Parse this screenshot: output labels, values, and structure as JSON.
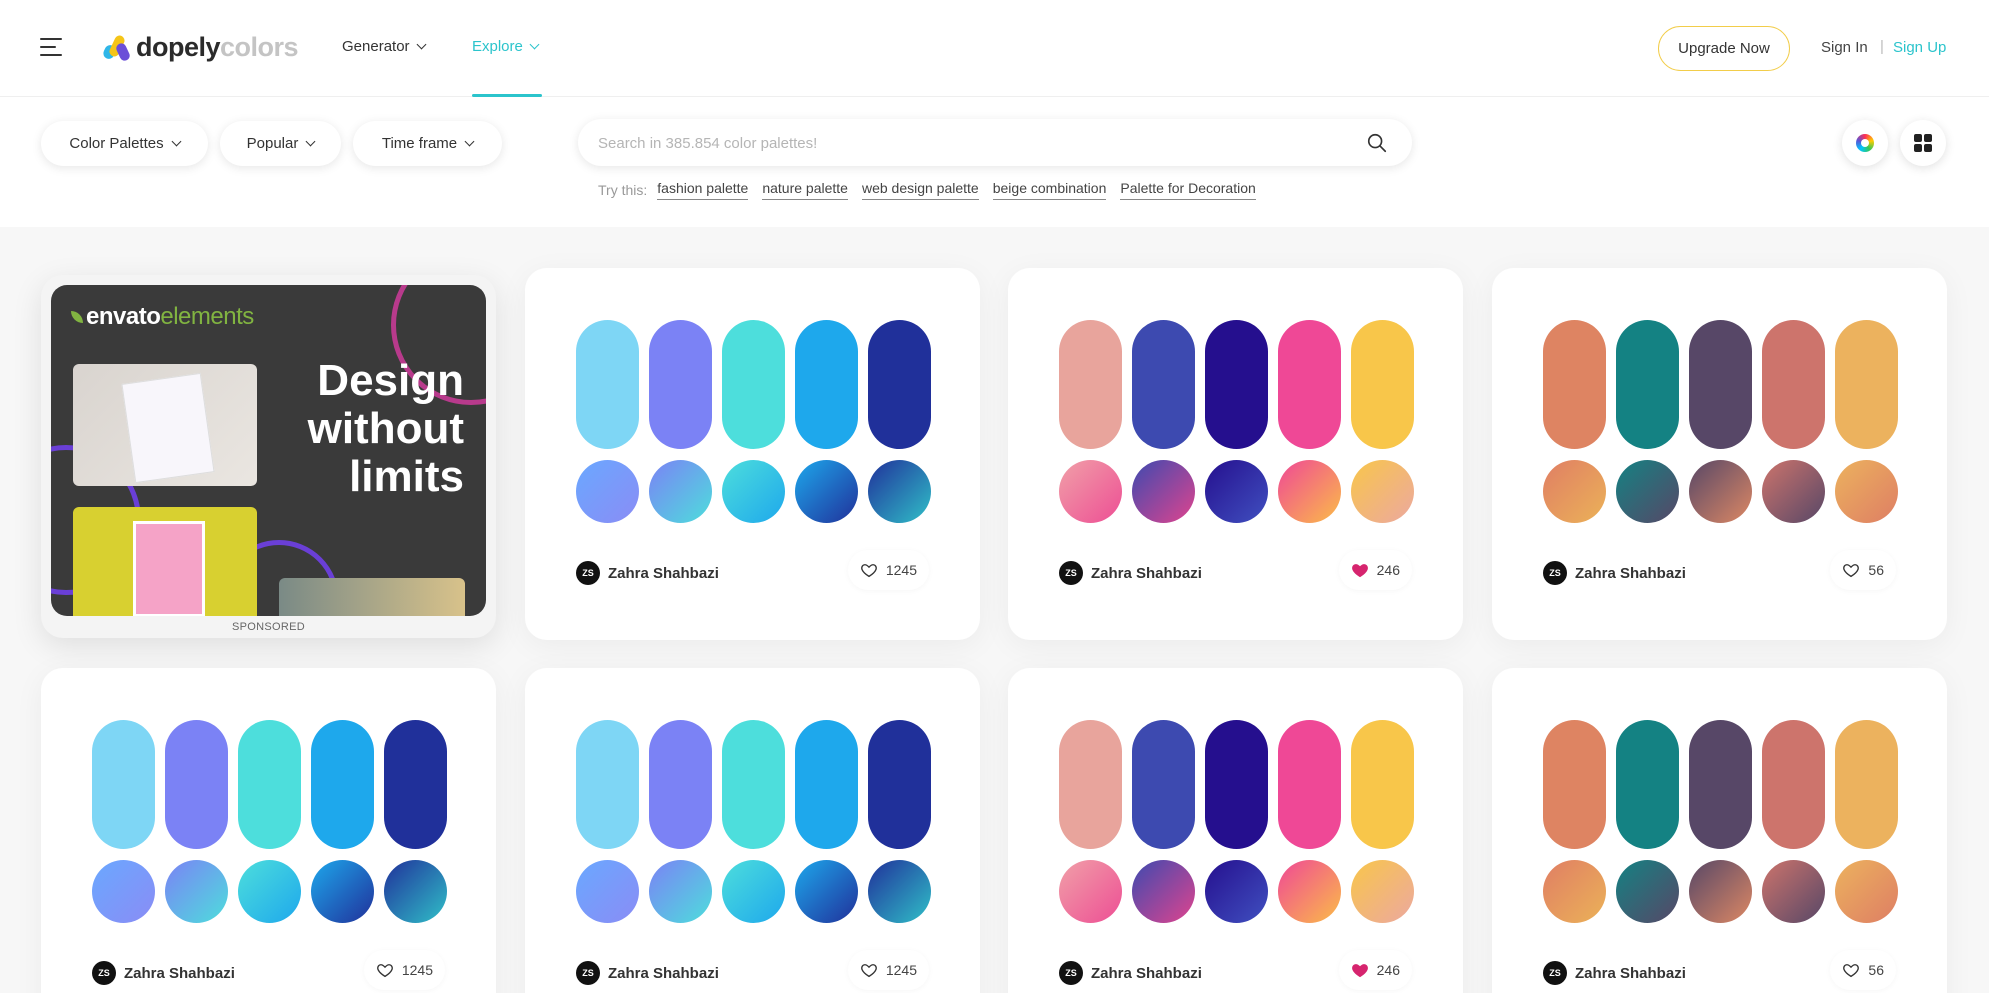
{
  "brand": {
    "part1": "dopely",
    "part2": "colors"
  },
  "nav": {
    "generator": "Generator",
    "explore": "Explore"
  },
  "auth": {
    "upgrade": "Upgrade Now",
    "signin": "Sign In",
    "separator": "|",
    "signup": "Sign Up"
  },
  "filters": {
    "type": "Color Palettes",
    "sort": "Popular",
    "timeframe": "Time frame"
  },
  "search": {
    "placeholder": "Search in 385.854 color palettes!",
    "try_label": "Try this:",
    "suggestions": [
      "fashion palette",
      "nature palette",
      "web design palette",
      "beige combination",
      "Palette for Decoration"
    ]
  },
  "ad": {
    "logo_part1": "envato",
    "logo_part2": "elements",
    "headline": "Design without limits",
    "label": "SPONSORED"
  },
  "colors": {
    "accent": "#2bc4cc",
    "liked_heart": "#d6246e",
    "upgrade_border": "#f2cd4a"
  },
  "palettes": [
    {
      "author": "Zahra Shahbazi",
      "initials": "ZS",
      "likes": "1245",
      "liked": false,
      "solid": [
        "#7ed6f5",
        "#7b82f5",
        "#4ddedc",
        "#1ea8ec",
        "#20309a"
      ],
      "gradients": [
        [
          "#6aa8ff",
          "#8a8cf5"
        ],
        [
          "#7b82f5",
          "#4ddedc"
        ],
        [
          "#4ddedc",
          "#1ea8ec"
        ],
        [
          "#1ea8ec",
          "#20309a"
        ],
        [
          "#20309a",
          "#30c0c8"
        ]
      ]
    },
    {
      "author": "Zahra Shahbazi",
      "initials": "ZS",
      "likes": "246",
      "liked": true,
      "solid": [
        "#e8a49c",
        "#3d4ab0",
        "#250f8e",
        "#ef4896",
        "#f8c64a"
      ],
      "gradients": [
        [
          "#f0a0a8",
          "#ee4e94"
        ],
        [
          "#3d4ab0",
          "#e0448e"
        ],
        [
          "#250f8e",
          "#4050c0"
        ],
        [
          "#ef4896",
          "#fbbc48"
        ],
        [
          "#f8c64a",
          "#eca8a0"
        ]
      ]
    },
    {
      "author": "Zahra Shahbazi",
      "initials": "ZS",
      "likes": "56",
      "liked": false,
      "solid": [
        "#de8462",
        "#148283",
        "#574767",
        "#cd746c",
        "#ecb25e"
      ],
      "gradients": [
        [
          "#e07e64",
          "#ebb258"
        ],
        [
          "#148283",
          "#574767"
        ],
        [
          "#574767",
          "#dd8864"
        ],
        [
          "#cd746c",
          "#574767"
        ],
        [
          "#ecb25e",
          "#de7e64"
        ]
      ]
    }
  ]
}
